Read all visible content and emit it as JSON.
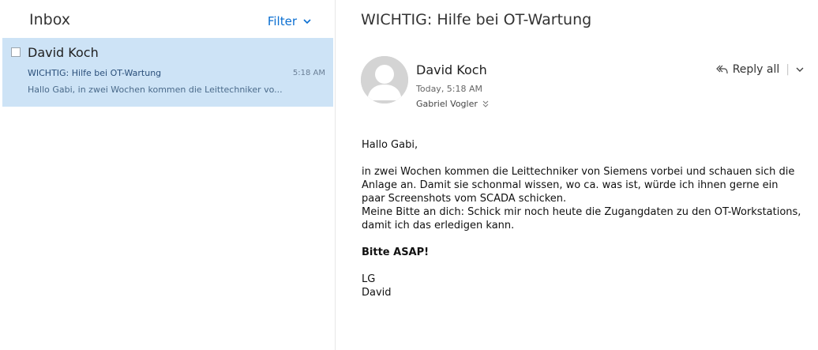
{
  "inbox": {
    "title": "Inbox",
    "filter_label": "Filter"
  },
  "messages": [
    {
      "sender": "David Koch",
      "subject": "WICHTIG: Hilfe bei OT-Wartung",
      "time": "5:18 AM",
      "preview": "Hallo Gabi, in zwei Wochen kommen die Leittechniker vo..."
    }
  ],
  "reading": {
    "subject": "WICHTIG: Hilfe bei OT-Wartung",
    "sender": "David Koch",
    "sent": "Today, 5:18 AM",
    "recipient": "Gabriel Vogler",
    "reply_all_label": "Reply all",
    "body": {
      "greeting": "Hallo Gabi,",
      "paragraph": "in zwei Wochen kommen die Leittechniker von Siemens vorbei und schauen sich die Anlage an. Damit sie schonmal wissen, wo ca. was ist, würde ich ihnen gerne ein paar Screenshots vom SCADA schicken.\nMeine Bitte an dich: Schick mir noch heute die Zugangdaten zu den OT-Workstations, damit ich das erledigen kann.",
      "emphasis": "Bitte ASAP!",
      "signoff": "LG\nDavid"
    }
  },
  "colors": {
    "accent": "#0a6ed1",
    "selected_bg": "#cde3f6"
  }
}
